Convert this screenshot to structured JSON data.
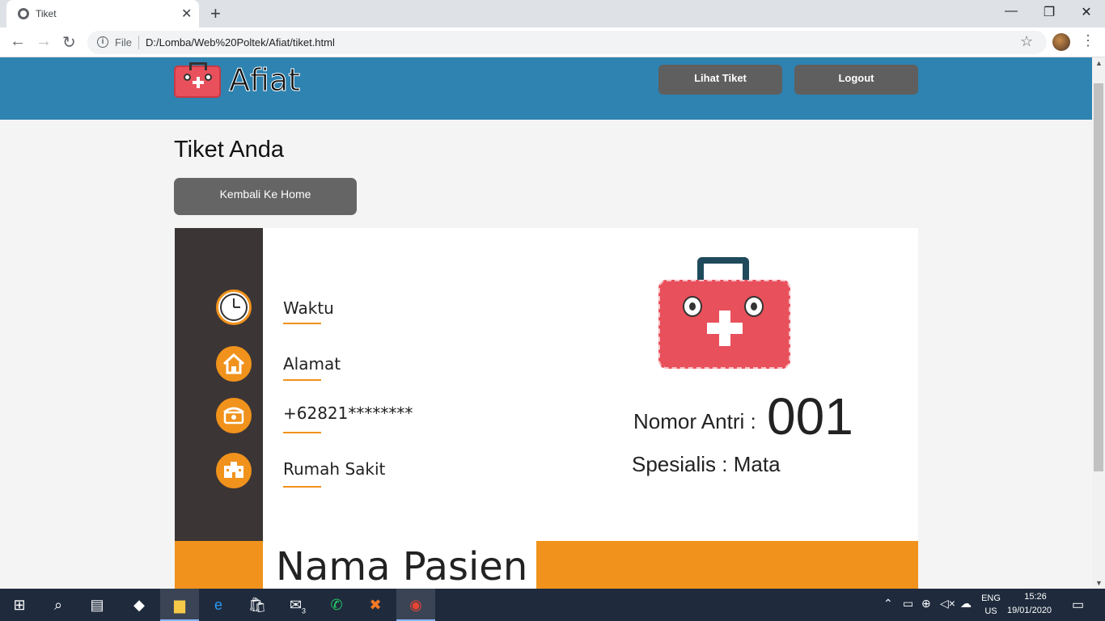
{
  "browser": {
    "tab_title": "Tiket",
    "file_label": "File",
    "url": "D:/Lomba/Web%20Poltek/Afiat/tiket.html"
  },
  "header": {
    "logo_text": "Afiat",
    "lihat_tiket_label": "Lihat Tiket",
    "logout_label": "Logout"
  },
  "page": {
    "title": "Tiket Anda",
    "home_button_label": "Kembali Ke Home"
  },
  "ticket": {
    "info": [
      {
        "icon": "clock-icon",
        "label": "Waktu"
      },
      {
        "icon": "home-icon",
        "label": "Alamat"
      },
      {
        "icon": "phone-icon",
        "label": "+62821********"
      },
      {
        "icon": "hospital-icon",
        "label": "Rumah Sakit"
      }
    ],
    "antri_label": "Nomor Antri :",
    "antri_number": "001",
    "spesialis": "Spesialis : Mata",
    "nama_pasien": "Nama Pasien"
  },
  "taskbar": {
    "lang_line1": "ENG",
    "lang_line2": "US",
    "time": "15:26",
    "date": "19/01/2020",
    "mail_badge": "3"
  },
  "colors": {
    "header_blue": "#2e83b1",
    "accent_orange": "#f0921b",
    "sidebar_dark": "#3b3535",
    "kit_red": "#e8505b"
  }
}
